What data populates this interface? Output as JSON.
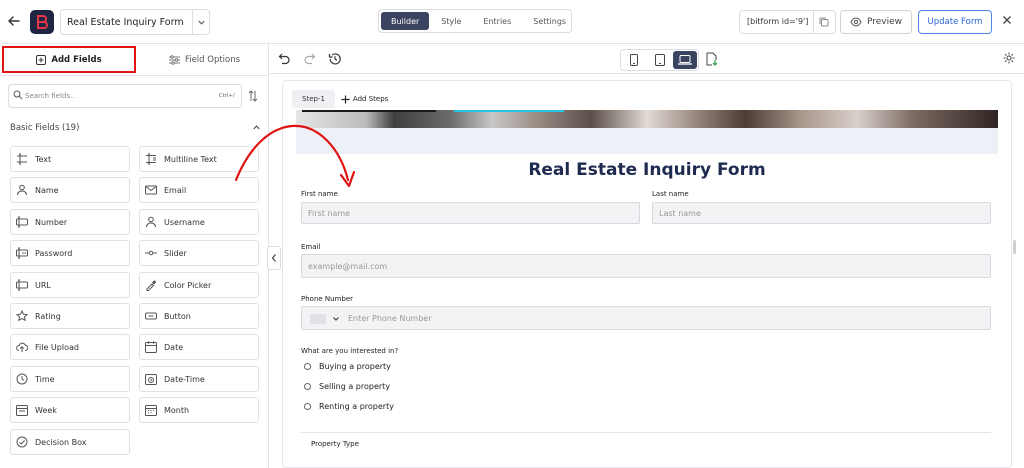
{
  "topbar": {
    "form_name": "Real Estate Inquiry Form",
    "tabs": [
      {
        "label": "Builder",
        "active": true
      },
      {
        "label": "Style",
        "active": false
      },
      {
        "label": "Entries",
        "active": false
      },
      {
        "label": "Settings",
        "active": false
      }
    ],
    "shortcode": "[bitform id='9']",
    "preview_label": "Preview",
    "update_label": "Update Form",
    "brand_color": "#1f2542"
  },
  "left_panel": {
    "tab_add_fields": "Add Fields",
    "tab_field_options": "Field Options",
    "search_placeholder": "Search fields..",
    "search_shortcut": "Ctrl+/",
    "section_title": "Basic Fields (19)",
    "fields": [
      {
        "label": "Text",
        "icon": "text-field-icon"
      },
      {
        "label": "Multiline Text",
        "icon": "multiline-text-icon"
      },
      {
        "label": "Name",
        "icon": "person-icon"
      },
      {
        "label": "Email",
        "icon": "envelope-icon"
      },
      {
        "label": "Number",
        "icon": "number-field-icon"
      },
      {
        "label": "Username",
        "icon": "user-icon"
      },
      {
        "label": "Password",
        "icon": "password-field-icon"
      },
      {
        "label": "Slider",
        "icon": "slider-icon"
      },
      {
        "label": "URL",
        "icon": "url-field-icon"
      },
      {
        "label": "Color Picker",
        "icon": "eyedropper-icon"
      },
      {
        "label": "Rating",
        "icon": "star-icon"
      },
      {
        "label": "Button",
        "icon": "button-icon"
      },
      {
        "label": "File Upload",
        "icon": "cloud-upload-icon"
      },
      {
        "label": "Date",
        "icon": "calendar-icon"
      },
      {
        "label": "Time",
        "icon": "clock-icon"
      },
      {
        "label": "Date-Time",
        "icon": "calendar-clock-icon"
      },
      {
        "label": "Week",
        "icon": "week-calendar-icon"
      },
      {
        "label": "Month",
        "icon": "month-calendar-icon"
      },
      {
        "label": "Decision Box",
        "icon": "check-circle-icon"
      }
    ],
    "highlight_color": "#e01414"
  },
  "form": {
    "step_label": "Step-1",
    "add_steps_label": "Add Steps",
    "title": "Real Estate Inquiry Form",
    "first_name_label": "First name",
    "first_name_placeholder": "First name",
    "last_name_label": "Last name",
    "last_name_placeholder": "Last name",
    "email_label": "Email",
    "email_placeholder": "example@mail.com",
    "phone_label": "Phone Number",
    "phone_placeholder": "Enter Phone Number",
    "interest_label": "What are you interested in?",
    "options": [
      "Buying a property",
      "Selling a property",
      "Renting a property"
    ],
    "property_type_label": "Property Type",
    "title_color": "#1e2a4f"
  },
  "annotation": {
    "arrow_color": "#e01414"
  }
}
